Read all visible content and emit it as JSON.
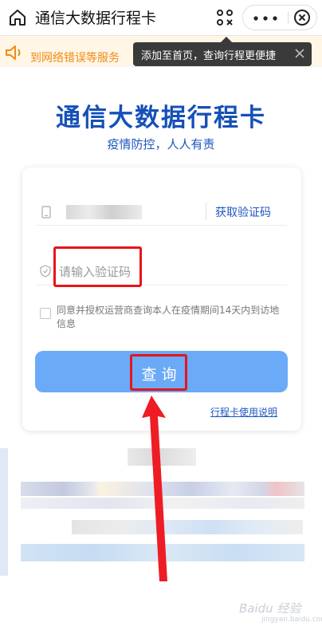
{
  "topbar": {
    "title": "通信大数据行程卡",
    "icons": [
      "home-icon",
      "scan-icon",
      "more-icon",
      "close-icon"
    ]
  },
  "notice": {
    "text": "到网络错误等服务"
  },
  "tooltip": {
    "text": "添加至首页，查询行程更便捷"
  },
  "brand": {
    "title": "通信大数据行程卡",
    "subtitle": "疫情防控，人人有责"
  },
  "form": {
    "get_code_label": "获取验证码",
    "code_placeholder": "请输入验证码",
    "agree_text": "同意并授权运营商查询本人在疫情期间14天内到访地信息",
    "query_label": "查询",
    "help_link": "行程卡使用说明"
  },
  "watermark": {
    "text": "Baidu 经验",
    "sub": "jingyan.baidu.com"
  },
  "colors": {
    "brand_blue": "#1550b8",
    "button_blue": "#6aaaf7",
    "notice_orange": "#f08a15",
    "highlight_red": "#e8141a"
  }
}
